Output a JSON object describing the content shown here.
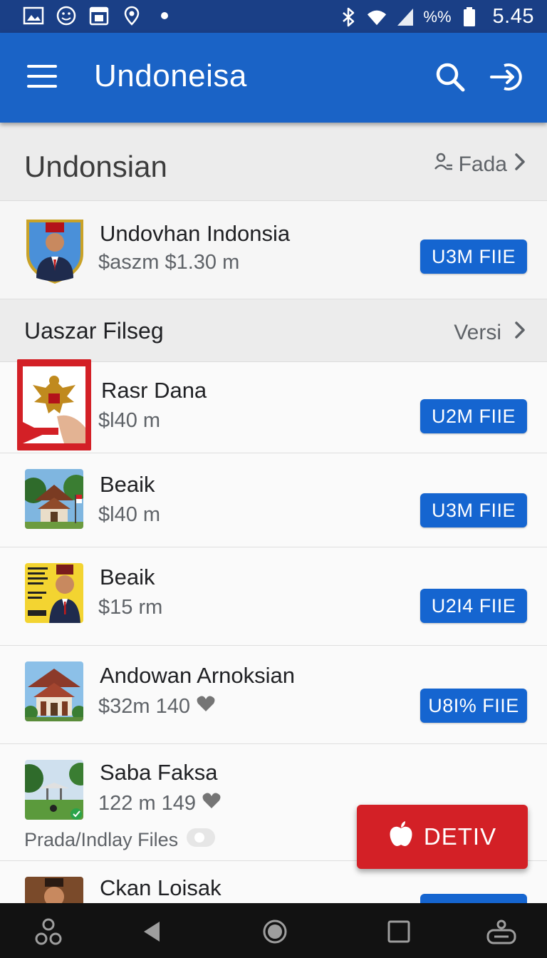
{
  "status_bar": {
    "time": "5.45",
    "battery_label": "%%",
    "left_icons": [
      "gallery-icon",
      "emoji-icon",
      "calendar-icon",
      "location-pin-icon",
      "dot-icon"
    ],
    "right_icons": [
      "bluetooth-icon",
      "wifi-icon",
      "signal-icon",
      "battery-icon"
    ]
  },
  "app_bar": {
    "title": "Undoneisa",
    "icons": [
      "menu-icon",
      "search-icon",
      "login-icon"
    ]
  },
  "section_1": {
    "title": "Undonsian",
    "action_label": "Fada",
    "action_icon": "people-icon"
  },
  "featured": {
    "name": "Undovhan Indonsia",
    "price": "$aszm $1.30 m",
    "button": "U3M FIIE"
  },
  "section_2": {
    "title": "Uaszar Filseg",
    "action_label": "Versi"
  },
  "items": [
    {
      "name": "Rasr Dana",
      "price": "$l40 m",
      "button": "U2M FIIE"
    },
    {
      "name": "Beaik",
      "price": "$l40 m",
      "button": "U3M FIIE"
    },
    {
      "name": "Beaik",
      "price": "$15 rm",
      "button": "U2I4 FIIE"
    },
    {
      "name": "Andowan Arnoksian",
      "price": "$32m 140",
      "button": "U8I% FIIE"
    },
    {
      "name": "Saba Faksa",
      "price": "122 m 149",
      "tertiary": "Prada/Indlay Files"
    },
    {
      "name": "Ckan Loisak"
    }
  ],
  "fab": {
    "label": "DETIV",
    "icon": "apple-icon"
  },
  "nav_bar": {
    "icons": [
      "assistant-icon",
      "back-icon",
      "home-icon",
      "recents-icon",
      "keyboard-icon"
    ]
  },
  "colors": {
    "status_bar": "#1a3f86",
    "app_bar": "#1a63c6",
    "button": "#1565d0",
    "fab": "#d32026",
    "nav_bar": "#121212"
  }
}
